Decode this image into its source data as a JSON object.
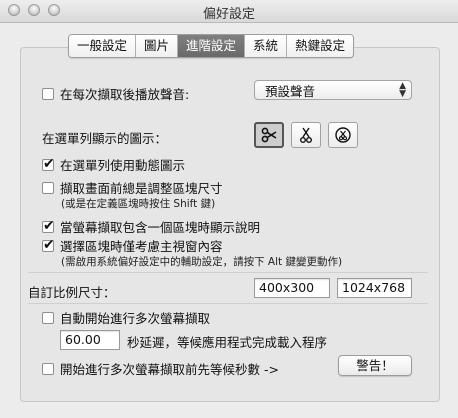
{
  "window": {
    "title": "偏好設定"
  },
  "tabs": [
    {
      "label": "一般設定",
      "selected": false
    },
    {
      "label": "圖片",
      "selected": false
    },
    {
      "label": "進階設定",
      "selected": true
    },
    {
      "label": "系統",
      "selected": false
    },
    {
      "label": "熱鍵設定",
      "selected": false
    }
  ],
  "sound": {
    "label": "在每次擷取後播放聲音:",
    "checked": false,
    "selected_value": "預設聲音"
  },
  "menubar_icon": {
    "label": "在選單列顯示的圖示：",
    "options": [
      "scissors-icon",
      "scissors-x-icon",
      "scissors-o-icon"
    ],
    "selected_index": 0
  },
  "animated_icon": {
    "label": "在選單列使用動態圖示",
    "checked": true
  },
  "adjust_region": {
    "label": "擷取畫面前總是調整區塊尺寸",
    "checked": false,
    "note": "(或是在定義區塊時按住 Shift 鍵)"
  },
  "region_info": {
    "label": "當螢幕擷取包含一個區塊時顯示說明",
    "checked": true
  },
  "region_window": {
    "label": "選擇區塊時僅考慮主視窗內容",
    "checked": true,
    "note": "(需啟用系統偏好設定中的輔助設定，請按下 Alt 鍵變更動作)"
  },
  "custom_ratio": {
    "label": "自訂比例尺寸：",
    "value1": "400x300",
    "value2": "1024x768"
  },
  "auto_start": {
    "label": "自動開始進行多次螢幕擷取",
    "checked": false,
    "seconds": "60.00",
    "suffix": "秒延遲，等候應用程式完成載入程序"
  },
  "countdown": {
    "label": "開始進行多次螢幕擷取前先等候秒數 ->",
    "checked": false,
    "button_label": "警告！"
  }
}
